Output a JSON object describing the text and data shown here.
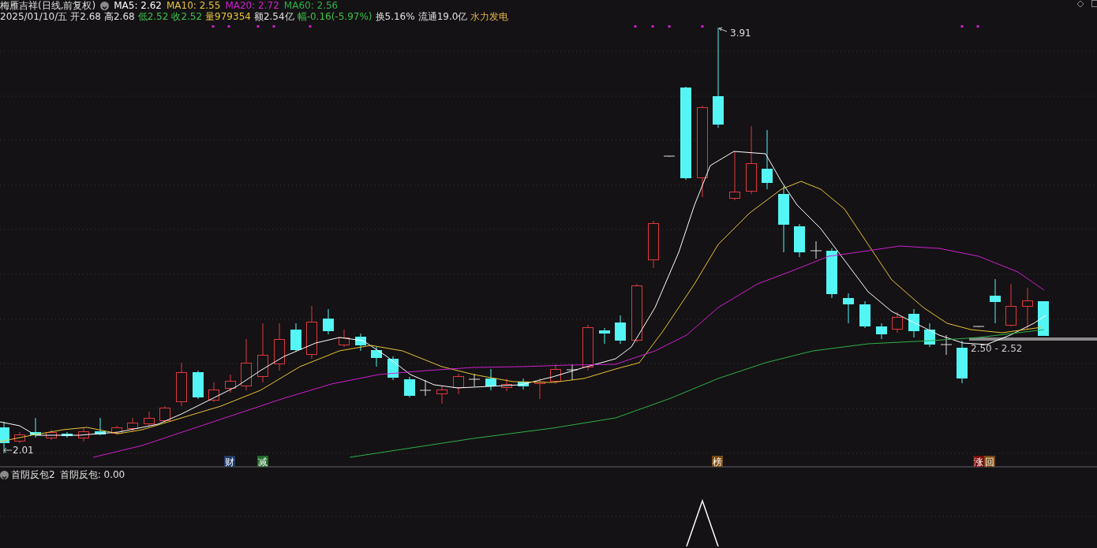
{
  "header": {
    "title": "梅雁吉祥(日线,前复权)",
    "moving_averages": [
      {
        "label": "MA5: 2.62",
        "color": "#ffffff"
      },
      {
        "label": "MA10: 2.55",
        "color": "#e8c43a"
      },
      {
        "label": "MA20: 2.72",
        "color": "#d21ed2"
      },
      {
        "label": "MA60: 2.56",
        "color": "#2fb24a"
      }
    ],
    "quote": [
      {
        "text": "2025/01/10/五",
        "color": "#e0e0e0"
      },
      {
        "text": "开2.68",
        "color": "#e0e0e0"
      },
      {
        "text": "高2.68",
        "color": "#e0e0e0"
      },
      {
        "text": "低2.52",
        "color": "#3cc24a"
      },
      {
        "text": "收2.52",
        "color": "#3cc24a"
      },
      {
        "text": "量979354",
        "color": "#e8c43a"
      },
      {
        "text": "额2.54亿",
        "color": "#e0e0e0"
      },
      {
        "text": "幅-0.16(-5.97%)",
        "color": "#3cc24a"
      },
      {
        "text": "换5.16%",
        "color": "#e0e0e0"
      },
      {
        "text": "流通19.0亿",
        "color": "#e0e0e0"
      },
      {
        "text": "水力发电",
        "color": "#e8b84a"
      }
    ]
  },
  "price_labels": {
    "high": "3.91",
    "low": "2.01",
    "range": "2.50 - 2.52"
  },
  "signals": [
    {
      "text": "财",
      "color": "#1f3a6a"
    },
    {
      "text": "减",
      "color": "#1f6a2a"
    },
    {
      "text": "榜",
      "color": "#7a4a10"
    },
    {
      "text": "涨",
      "color": "#7a0c0c"
    },
    {
      "text": "回",
      "color": "#7a4a10"
    }
  ],
  "indicator": {
    "name": "首阴反包2",
    "value": "首阴反包: 0.00"
  }
}
